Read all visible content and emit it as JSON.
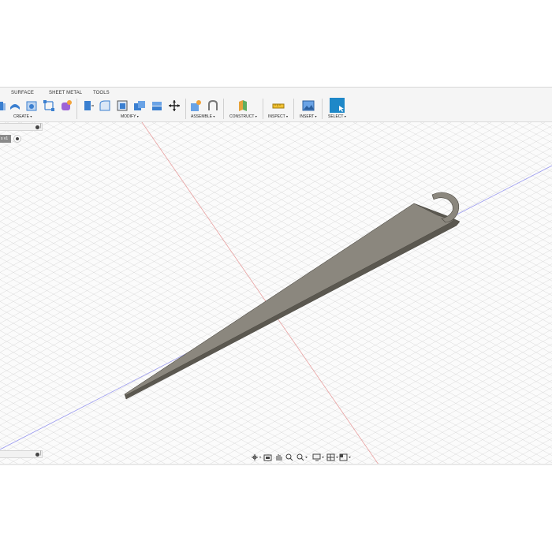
{
  "tabs": [
    "SURFACE",
    "SHEET METAL",
    "TOOLS"
  ],
  "groups": {
    "create": "CREATE",
    "modify": "MODIFY",
    "assemble": "ASSEMBLE",
    "construct": "CONSTRUCT",
    "inspect": "INSPECT",
    "insert": "INSERT",
    "select": "SELECT"
  },
  "caret": "▾",
  "browser": {
    "item_label": "s v1"
  },
  "colors": {
    "accent": "#1e88c8",
    "model_top": "#8b877e",
    "model_side": "#5b5850",
    "grid": "#d9d9d9",
    "axis_red": "#e8a0a0",
    "axis_blue": "#9a9af0"
  },
  "icons": {
    "tools": [
      "extrude-icon",
      "revolve-icon",
      "sweep-icon",
      "sketch-icon",
      "form-icon",
      "press-pull-icon",
      "fillet-icon",
      "shell-icon",
      "combine-icon",
      "align-icon",
      "move-icon",
      "new-component-icon",
      "joint-icon",
      "offset-plane-icon",
      "measure-icon",
      "insert-image-icon",
      "select-icon"
    ],
    "nav": [
      "orbit-icon",
      "look-at-icon",
      "pan-icon",
      "zoom-window-icon",
      "zoom-icon",
      "display-settings-icon",
      "grid-settings-icon",
      "viewports-icon"
    ]
  }
}
